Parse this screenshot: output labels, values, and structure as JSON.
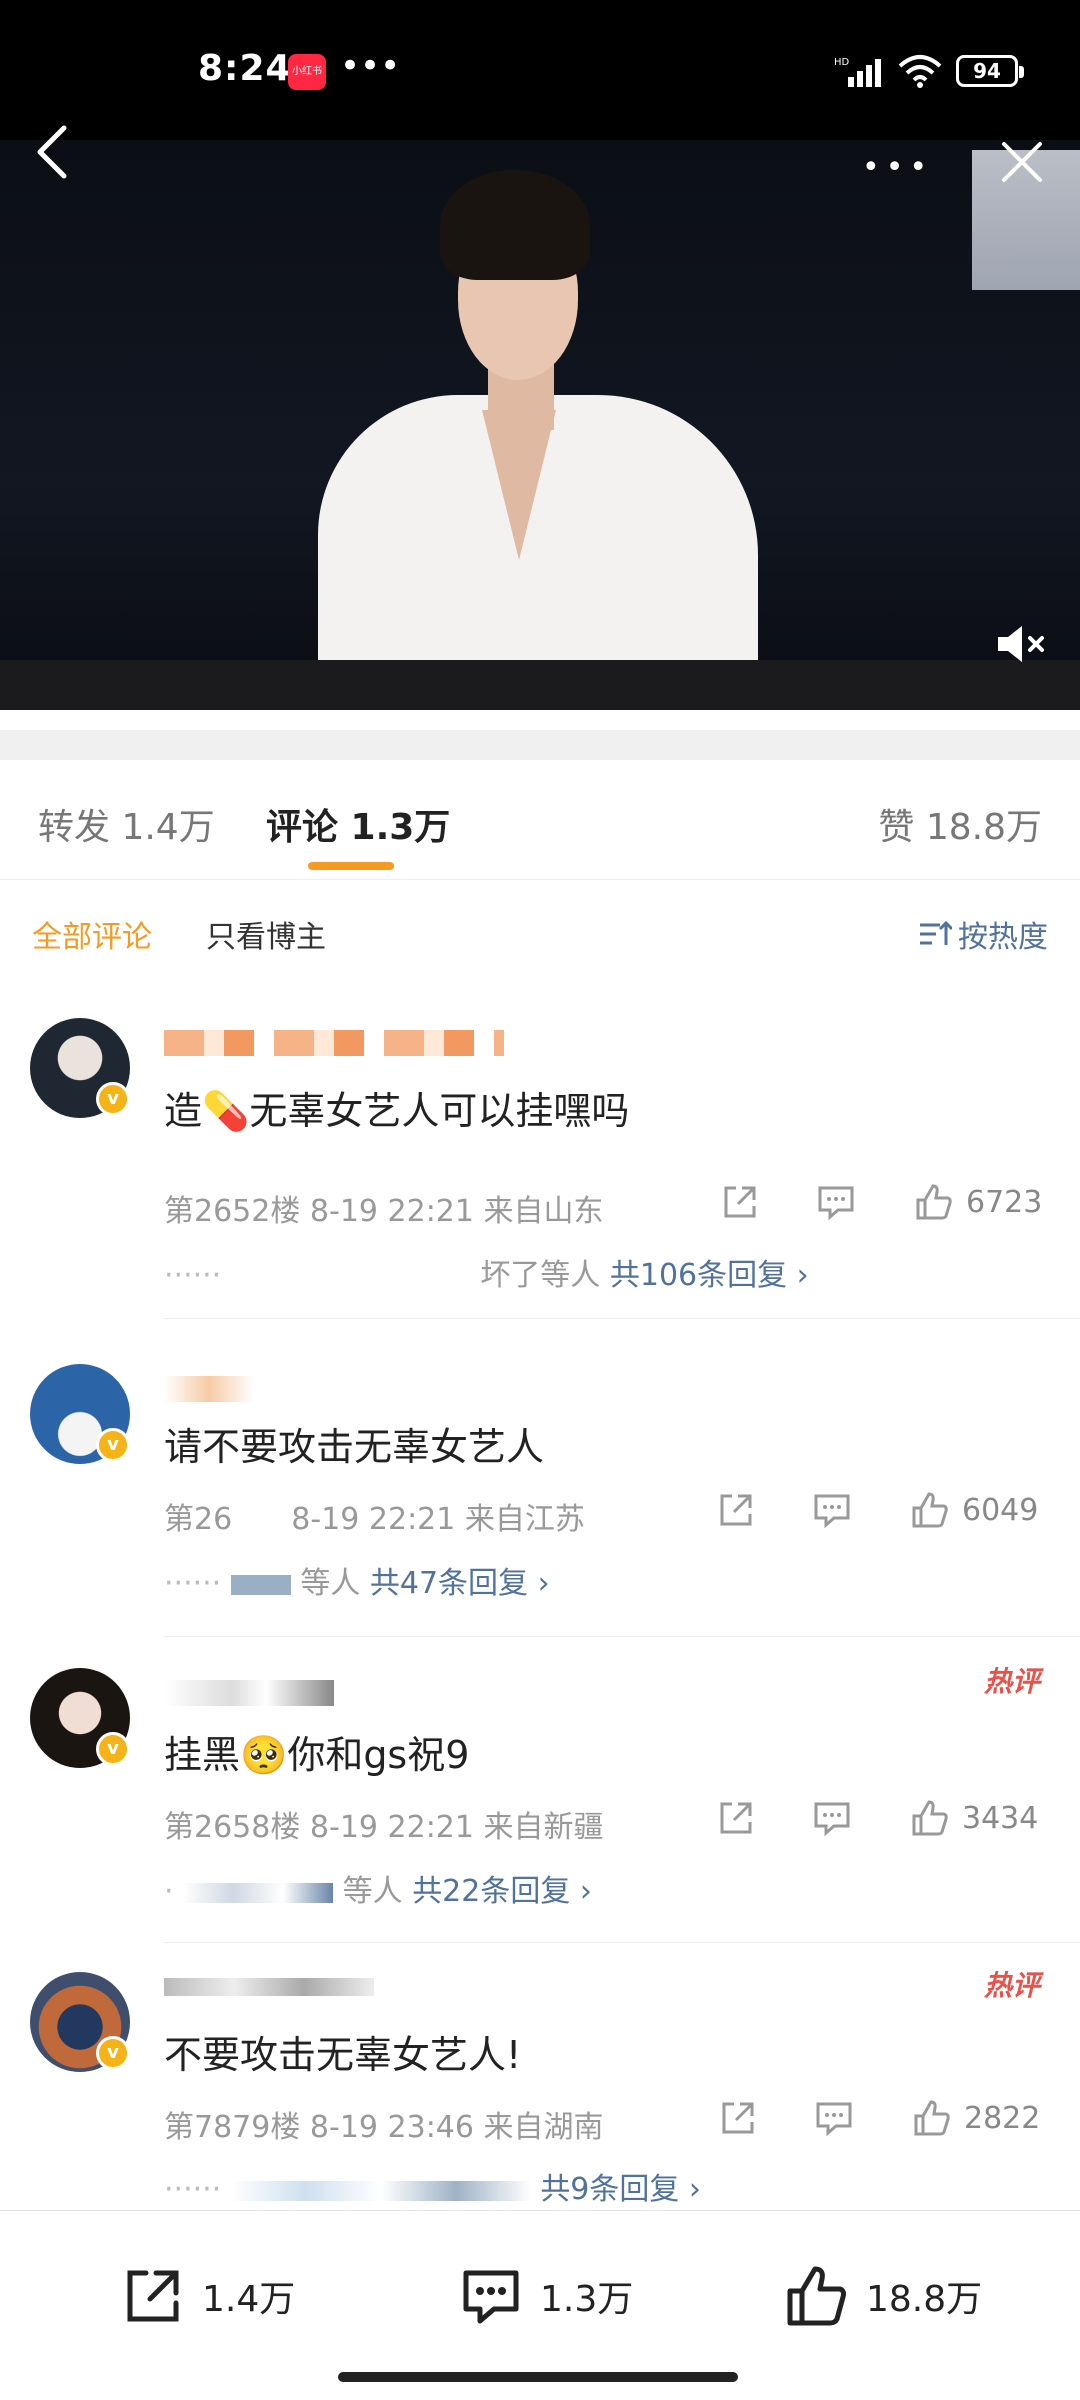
{
  "status_bar": {
    "time": "8:24",
    "app_badge": "小红书",
    "more": "•••",
    "network": "HD",
    "battery": "94"
  },
  "video": {
    "more_label": "•••"
  },
  "tabs": [
    {
      "label": "转发 1.4万"
    },
    {
      "label": "评论 1.3万"
    },
    {
      "label": "赞 18.8万"
    }
  ],
  "filters": {
    "all": "全部评论",
    "blogger_only": "只看博主",
    "sort": "按热度"
  },
  "comments": [
    {
      "text": "造💊无辜女艺人可以挂嘿吗",
      "floor": "第2652楼",
      "time": "8-19 22:21",
      "location": "来自山东",
      "likes": "6723",
      "reply_prefix": "坏了等人",
      "reply_link": "共106条回复 ›",
      "hot": ""
    },
    {
      "text": "请不要攻击无辜女艺人",
      "floor": "第26",
      "time": "8-19 22:21",
      "location": "来自江苏",
      "likes": "6049",
      "reply_prefix": "等人",
      "reply_link": "共47条回复 ›",
      "hot": ""
    },
    {
      "text": "挂黑🥺你和gs祝9",
      "floor": "第2658楼",
      "time": "8-19 22:21",
      "location": "来自新疆",
      "likes": "3434",
      "reply_prefix": "等人",
      "reply_link": "共22条回复 ›",
      "hot": "热评"
    },
    {
      "text": "不要攻击无辜女艺人!",
      "floor": "第7879楼",
      "time": "8-19 23:46",
      "location": "来自湖南",
      "likes": "2822",
      "reply_prefix": "",
      "reply_link": "共9条回复 ›",
      "hot": "热评"
    }
  ],
  "bottom_bar": {
    "reposts": "1.4万",
    "comments": "1.3万",
    "likes": "18.8万"
  },
  "colors": {
    "accent": "#f59a23",
    "link": "#50729c",
    "hot": "#e9514a",
    "verified": "#f5b317"
  },
  "icons": [
    "back-icon",
    "more-icon",
    "close-icon",
    "mute-icon",
    "sort-icon",
    "share-icon",
    "comment-icon",
    "like-icon",
    "verified-icon"
  ]
}
